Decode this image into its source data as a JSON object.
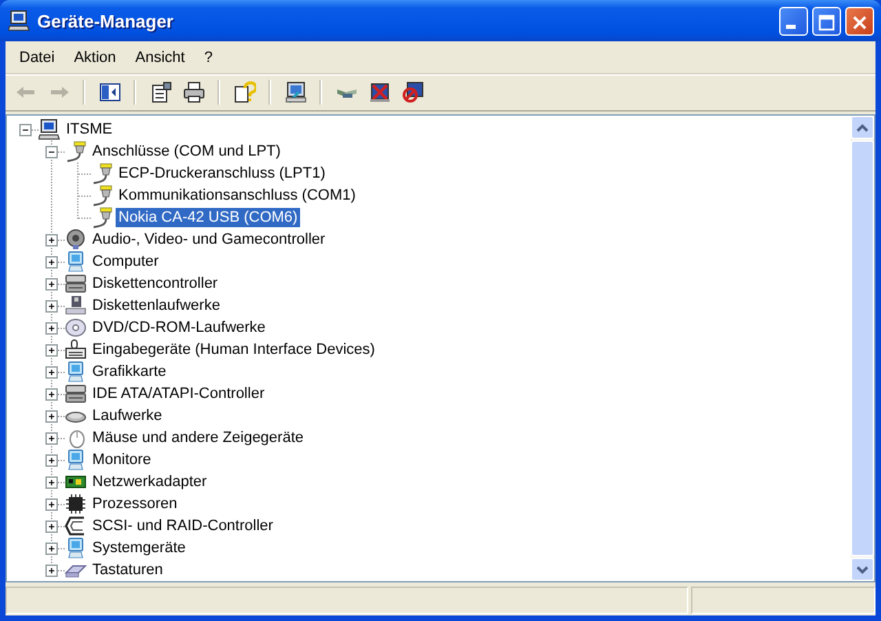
{
  "window": {
    "title": "Geräte-Manager"
  },
  "menu": [
    "Datei",
    "Aktion",
    "Ansicht",
    "?"
  ],
  "toolbar": [
    [
      {
        "kind": "back",
        "disabled": true
      },
      {
        "kind": "forward",
        "disabled": true
      }
    ],
    [
      {
        "kind": "tree-pane"
      }
    ],
    [
      {
        "kind": "properties"
      },
      {
        "kind": "print"
      }
    ],
    [
      {
        "kind": "help"
      }
    ],
    [
      {
        "kind": "scan"
      }
    ],
    [
      {
        "kind": "update"
      },
      {
        "kind": "uninstall"
      },
      {
        "kind": "disable"
      }
    ]
  ],
  "tree": [
    {
      "label": "ITSME",
      "kind": "computer",
      "expanded": true,
      "selected": false,
      "children": [
        {
          "label": "Anschlüsse (COM und LPT)",
          "kind": "port",
          "expanded": true,
          "selected": false,
          "children": [
            {
              "label": "ECP-Druckeranschluss (LPT1)",
              "kind": "port",
              "selected": false
            },
            {
              "label": "Kommunikationsanschluss (COM1)",
              "kind": "port",
              "selected": false
            },
            {
              "label": "Nokia CA-42 USB (COM6)",
              "kind": "port",
              "selected": true
            }
          ]
        },
        {
          "label": "Audio-, Video- und Gamecontroller",
          "kind": "speaker",
          "expanded": false,
          "selected": false
        },
        {
          "label": "Computer",
          "kind": "monitor",
          "expanded": false,
          "selected": false
        },
        {
          "label": "Diskettencontroller",
          "kind": "controller",
          "expanded": false,
          "selected": false
        },
        {
          "label": "Diskettenlaufwerke",
          "kind": "floppy",
          "expanded": false,
          "selected": false
        },
        {
          "label": "DVD/CD-ROM-Laufwerke",
          "kind": "disc",
          "expanded": false,
          "selected": false
        },
        {
          "label": "Eingabegeräte (Human Interface Devices)",
          "kind": "hid",
          "expanded": false,
          "selected": false
        },
        {
          "label": "Grafikkarte",
          "kind": "monitor",
          "expanded": false,
          "selected": false
        },
        {
          "label": "IDE ATA/ATAPI-Controller",
          "kind": "controller",
          "expanded": false,
          "selected": false
        },
        {
          "label": "Laufwerke",
          "kind": "drive",
          "expanded": false,
          "selected": false
        },
        {
          "label": "Mäuse und andere Zeigegeräte",
          "kind": "mouse",
          "expanded": false,
          "selected": false
        },
        {
          "label": "Monitore",
          "kind": "monitor",
          "expanded": false,
          "selected": false
        },
        {
          "label": "Netzwerkadapter",
          "kind": "network",
          "expanded": false,
          "selected": false
        },
        {
          "label": "Prozessoren",
          "kind": "chip",
          "expanded": false,
          "selected": false
        },
        {
          "label": "SCSI- und RAID-Controller",
          "kind": "scsi",
          "expanded": false,
          "selected": false
        },
        {
          "label": "Systemgeräte",
          "kind": "monitor",
          "expanded": false,
          "selected": false
        },
        {
          "label": "Tastaturen",
          "kind": "keyboard",
          "expanded": false,
          "selected": false
        }
      ]
    }
  ]
}
